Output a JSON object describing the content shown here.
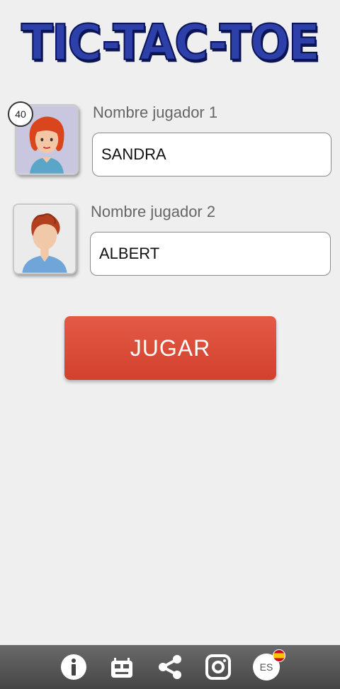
{
  "app": {
    "title": "TIC-TAC-TOE"
  },
  "players": [
    {
      "label": "Nombre jugador 1",
      "name": "SANDRA",
      "avatar": "girl-red-hair-avatar",
      "level": "40"
    },
    {
      "label": "Nombre jugador 2",
      "name": "ALBERT",
      "avatar": "boy-red-hair-avatar"
    }
  ],
  "play_button": {
    "label": "JUGAR",
    "color": "#dc4a35"
  },
  "bottom_bar": {
    "icons": [
      "info-icon",
      "robot-icon",
      "share-icon",
      "instagram-icon",
      "language-icon"
    ],
    "language": "ES"
  },
  "colors": {
    "title": "#2d3fa8",
    "background": "#efefef",
    "bar": "#555555"
  }
}
